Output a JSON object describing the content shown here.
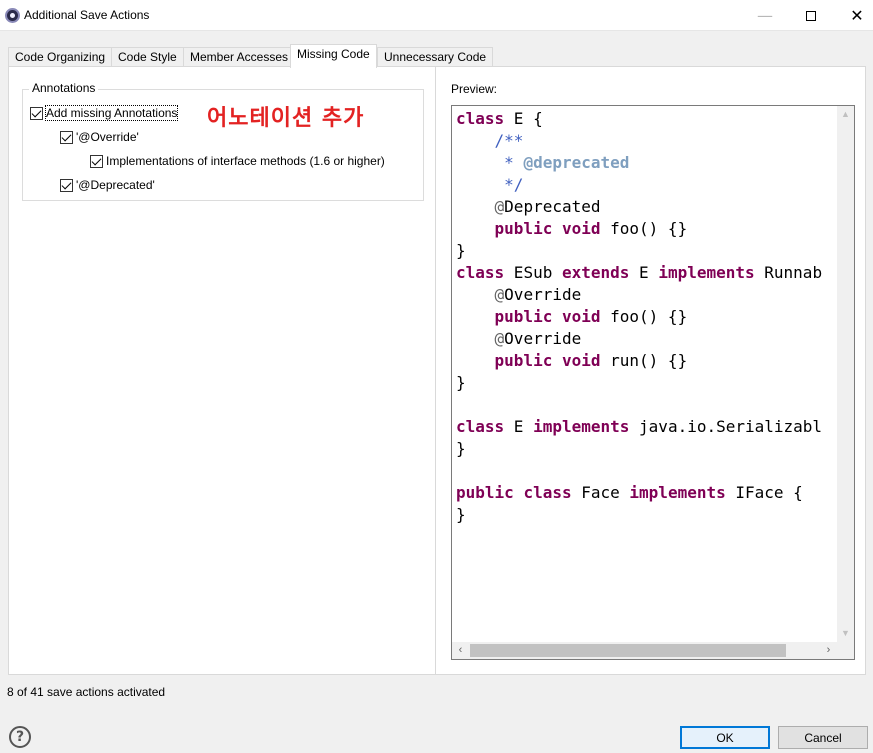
{
  "window": {
    "title": "Additional Save Actions"
  },
  "tabs": [
    {
      "label": "Code Organizing",
      "active": false
    },
    {
      "label": "Code Style",
      "active": false
    },
    {
      "label": "Member Accesses",
      "active": false
    },
    {
      "label": "Missing Code",
      "active": true
    },
    {
      "label": "Unnecessary Code",
      "active": false
    }
  ],
  "annotations_group": {
    "legend": "Annotations",
    "add_missing": {
      "label": "Add missing Annotations",
      "checked": true
    },
    "override": {
      "label": "'@Override'",
      "checked": true
    },
    "implementations": {
      "label": "Implementations of interface methods (1.6 or higher)",
      "checked": true
    },
    "deprecated": {
      "label": "'@Deprecated'",
      "checked": true
    }
  },
  "overlay_note": "어노테이션 추가",
  "preview": {
    "label": "Preview:",
    "code": {
      "l1_kw": "class",
      "l1_rest": " E {",
      "l2": "    /**",
      "l3_star": "     * ",
      "l3_tag": "@deprecated",
      "l4": "     */",
      "l5_at": "    @",
      "l5_name": "Deprecated",
      "l6_kw1": "public",
      "l6_kw2": "void",
      "l6_rest": " foo() {}",
      "l7": "}",
      "l8_kw1": "class",
      "l8_mid1": " ESub ",
      "l8_kw2": "extends",
      "l8_mid2": " E ",
      "l8_kw3": "implements",
      "l8_rest": " Runnab",
      "l9_at": "    @",
      "l9_name": "Override",
      "l10_kw1": "public",
      "l10_kw2": "void",
      "l10_rest": " foo() {}",
      "l11_at": "    @",
      "l11_name": "Override",
      "l12_kw1": "public",
      "l12_kw2": "void",
      "l12_rest": " run() {}",
      "l13": "}",
      "l15_kw1": "class",
      "l15_mid": " E ",
      "l15_kw2": "implements",
      "l15_rest": " java.io.Serializabl",
      "l16": "}",
      "l18_kw1": "public",
      "l18_kw2": "class",
      "l18_mid": " Face ",
      "l18_kw3": "implements",
      "l18_rest": " IFace {",
      "l19": "}"
    }
  },
  "status": "8 of 41 save actions activated",
  "buttons": {
    "ok": "OK",
    "cancel": "Cancel"
  }
}
